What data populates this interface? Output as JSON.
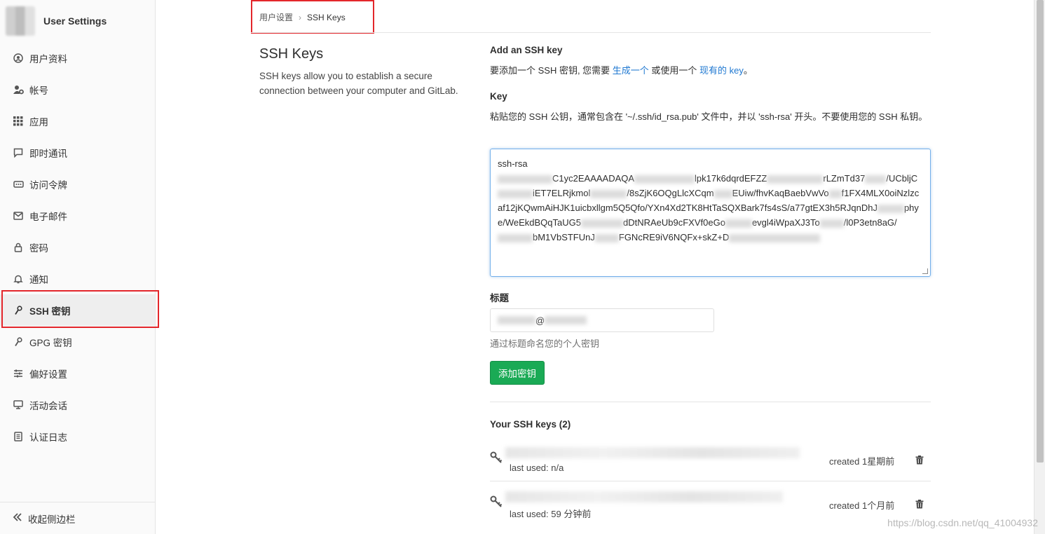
{
  "sidebar": {
    "title": "User Settings",
    "items": [
      {
        "label": "用户资料",
        "icon": "profile-icon"
      },
      {
        "label": "帐号",
        "icon": "account-gear-icon"
      },
      {
        "label": "应用",
        "icon": "apps-grid-icon"
      },
      {
        "label": "即时通讯",
        "icon": "chat-icon"
      },
      {
        "label": "访问令牌",
        "icon": "token-icon"
      },
      {
        "label": "电子邮件",
        "icon": "mail-icon"
      },
      {
        "label": "密码",
        "icon": "lock-icon"
      },
      {
        "label": "通知",
        "icon": "bell-icon"
      },
      {
        "label": "SSH 密钥",
        "icon": "key-icon",
        "active": true
      },
      {
        "label": "GPG 密钥",
        "icon": "key-icon"
      },
      {
        "label": "偏好设置",
        "icon": "sliders-icon"
      },
      {
        "label": "活动会话",
        "icon": "monitor-icon"
      },
      {
        "label": "认证日志",
        "icon": "log-icon"
      }
    ],
    "collapse_label": "收起侧边栏"
  },
  "breadcrumb": {
    "parent": "用户设置",
    "current": "SSH Keys"
  },
  "description": {
    "title": "SSH Keys",
    "text": "SSH keys allow you to establish a secure connection between your computer and GitLab."
  },
  "form": {
    "add_heading": "Add an SSH key",
    "add_text_prefix": "要添加一个 SSH 密钥, 您需要 ",
    "add_link_generate": "生成一个",
    "add_text_mid": " 或使用一个 ",
    "add_link_existing": "现有的 key",
    "add_text_suffix": "。",
    "key_label": "Key",
    "key_help": "粘贴您的 SSH 公钥，通常包含在 '~/.ssh/id_rsa.pub' 文件中，并以 'ssh-rsa' 开头。不要使用您的 SSH 私钥。",
    "key_value_lines": [
      "ssh-rsa",
      "C1yc2EAAAADAQA",
      "lpk17k6dqrdEFZZ",
      "rLZmTd37",
      "/U",
      "CbljC",
      "iET7ELRjkmol",
      "/8sZjK6OQgLlcXCqm",
      "EUiw/fhvKaqBaebVwVo",
      "f1FX4M",
      "LX0oiNzlzcaf12jKQwmAiHJK1uicbxllgm5Q5Qfo/YXn4Xd2TK8HtTaSQXBark7fs4sS/a77gtEX3h5RJqn",
      "DhJ",
      "phye/WeEkdBQqTaUG5",
      "dDtNRAeUb9cFXVf0eGo",
      "evgl4iWpaXJ3To",
      "/l",
      "0P3etn8aG/",
      "bM1VbSTFUnJ",
      "FGNcRE9iV6NQFx+skZ+D"
    ],
    "title_label": "标题",
    "title_value_fragment": "@",
    "title_hint": "通过标题命名您的个人密钥",
    "submit_label": "添加密钥"
  },
  "keys_list": {
    "heading": "Your SSH keys (2)",
    "keys": [
      {
        "last_used": "last used: n/a",
        "created": "created 1星期前"
      },
      {
        "last_used": "last used: 59 分钟前",
        "created": "created 1个月前"
      }
    ]
  },
  "watermark": "https://blog.csdn.net/qq_41004932",
  "colors": {
    "accent_link": "#1f78d1",
    "primary_button": "#1aaa55",
    "highlight_box": "#e3262b"
  }
}
